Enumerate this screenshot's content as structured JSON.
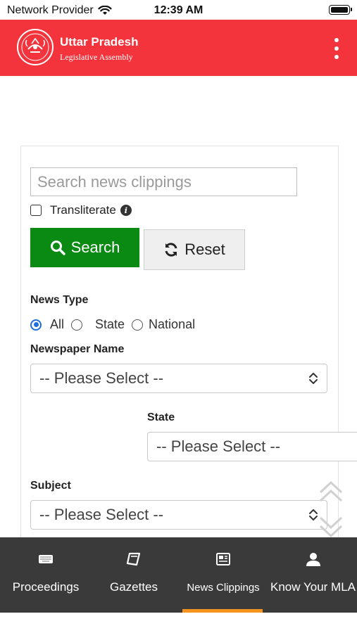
{
  "status_bar": {
    "carrier": "Network Provider",
    "time": "12:39 AM"
  },
  "header": {
    "title": "Uttar Pradesh",
    "subtitle": "Legislative Assembly",
    "logo_text": "उत्तर प्रदेश विधान सभा"
  },
  "form": {
    "search_placeholder": "Search news clippings",
    "transliterate_label": "Transliterate",
    "transliterate_checked": false,
    "search_button": "Search",
    "reset_button": "Reset",
    "news_type_label": "News Type",
    "news_type_options": [
      "All",
      "State",
      "National"
    ],
    "news_type_selected": "All",
    "newspaper_label": "Newspaper Name",
    "newspaper_value": "-- Please Select --",
    "state_label": "State",
    "state_value": "-- Please Select --",
    "subject_label": "Subject",
    "subject_value": "-- Please Select --"
  },
  "tabs": [
    {
      "label": "Proceedings",
      "icon": "keyboard-icon"
    },
    {
      "label": "Gazettes",
      "icon": "book-icon"
    },
    {
      "label": "News Clippings",
      "icon": "newspaper-icon",
      "active": true
    },
    {
      "label": "Know Your MLA",
      "icon": "user-icon"
    }
  ],
  "colors": {
    "header": "#f3343c",
    "search_button": "#0a8a12",
    "tabbar": "#3a3a3a",
    "active_tab_indicator": "#f7941d",
    "radio_selected": "#1d6fe0"
  }
}
